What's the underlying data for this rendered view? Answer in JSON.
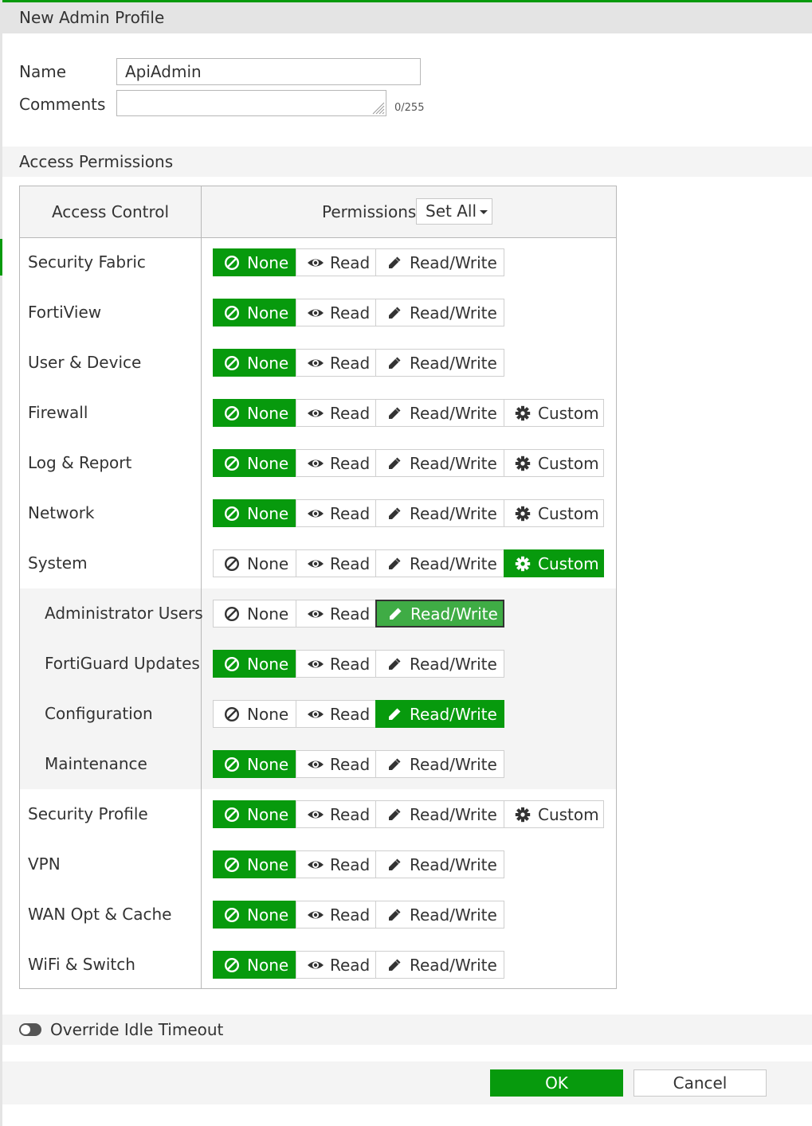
{
  "window": {
    "title": "New Admin Profile"
  },
  "form": {
    "name_label": "Name",
    "name_value": "ApiAdmin",
    "comments_label": "Comments",
    "comments_value": "",
    "comments_count": "0/255"
  },
  "access_section": {
    "title": "Access Permissions",
    "col_access": "Access Control",
    "col_permissions": "Permissions",
    "set_all_label": "Set All"
  },
  "option_labels": {
    "none": "None",
    "read": "Read",
    "readwrite": "Read/Write",
    "custom": "Custom"
  },
  "rows": [
    {
      "label": "Security Fabric",
      "selected": "none",
      "has_custom": false,
      "indent": false
    },
    {
      "label": "FortiView",
      "selected": "none",
      "has_custom": false,
      "indent": false
    },
    {
      "label": "User & Device",
      "selected": "none",
      "has_custom": false,
      "indent": false
    },
    {
      "label": "Firewall",
      "selected": "none",
      "has_custom": true,
      "indent": false
    },
    {
      "label": "Log & Report",
      "selected": "none",
      "has_custom": true,
      "indent": false
    },
    {
      "label": "Network",
      "selected": "none",
      "has_custom": true,
      "indent": false
    },
    {
      "label": "System",
      "selected": "custom",
      "has_custom": true,
      "indent": false
    },
    {
      "label": "Administrator Users",
      "selected": "readwrite",
      "has_custom": false,
      "indent": true,
      "focused": true
    },
    {
      "label": "FortiGuard Updates",
      "selected": "none",
      "has_custom": false,
      "indent": true
    },
    {
      "label": "Configuration",
      "selected": "readwrite",
      "has_custom": false,
      "indent": true
    },
    {
      "label": "Maintenance",
      "selected": "none",
      "has_custom": false,
      "indent": true
    },
    {
      "label": "Security Profile",
      "selected": "none",
      "has_custom": true,
      "indent": false
    },
    {
      "label": "VPN",
      "selected": "none",
      "has_custom": false,
      "indent": false
    },
    {
      "label": "WAN Opt & Cache",
      "selected": "none",
      "has_custom": false,
      "indent": false
    },
    {
      "label": "WiFi & Switch",
      "selected": "none",
      "has_custom": false,
      "indent": false
    }
  ],
  "override": {
    "label": "Override Idle Timeout",
    "enabled": false
  },
  "footer": {
    "ok_label": "OK",
    "cancel_label": "Cancel"
  },
  "colors": {
    "accent": "#079a0d",
    "focused_selected": "#3fac45",
    "header_bg": "#e4e4e4",
    "section_bg": "#f4f4f4"
  }
}
